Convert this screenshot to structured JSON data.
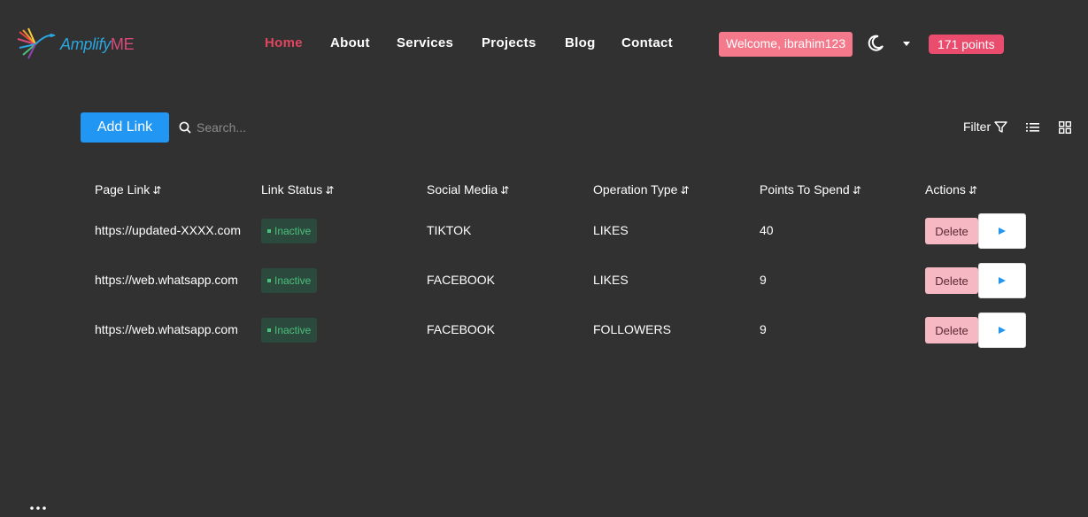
{
  "brand": {
    "name_part1": "Amplify",
    "name_part2": "ME"
  },
  "nav": {
    "items": [
      {
        "label": "Home",
        "active": true
      },
      {
        "label": "About",
        "active": false
      },
      {
        "label": "Services",
        "active": false
      },
      {
        "label": "Projects",
        "active": false
      },
      {
        "label": "Blog",
        "active": false
      },
      {
        "label": "Contact",
        "active": false
      }
    ],
    "welcome": "Welcome, ibrahim123",
    "points": "171 points"
  },
  "toolbar": {
    "add_link_label": "Add Link",
    "search_placeholder": "Search...",
    "filter_label": "Filter"
  },
  "table": {
    "columns": [
      "Page Link",
      "Link Status",
      "Social Media",
      "Operation Type",
      "Points To Spend",
      "Actions"
    ],
    "rows": [
      {
        "page_link": "https://updated-XXXX.com",
        "status": "Inactive",
        "social": "TIKTOK",
        "operation": "LIKES",
        "points": "40",
        "delete_label": "Delete"
      },
      {
        "page_link": "https://web.whatsapp.com",
        "status": "Inactive",
        "social": "FACEBOOK",
        "operation": "LIKES",
        "points": "9",
        "delete_label": "Delete"
      },
      {
        "page_link": "https://web.whatsapp.com",
        "status": "Inactive",
        "social": "FACEBOOK",
        "operation": "FOLLOWERS",
        "points": "9",
        "delete_label": "Delete"
      }
    ]
  },
  "colors": {
    "background": "#313131",
    "accent_blue": "#2196f3",
    "active_nav": "#e0465f",
    "welcome_bg": "#f47a8b",
    "points_bg": "#ea4c6d",
    "status_bg": "#2b4a3d",
    "status_text": "#4cbf7b",
    "delete_bg": "#f6b8c3"
  },
  "icons": [
    "hummingbird-logo-icon",
    "moon-icon",
    "caret-down-icon",
    "search-icon",
    "filter-icon",
    "list-view-icon",
    "grid-view-icon",
    "sort-icon",
    "play-icon",
    "more-icon"
  ]
}
